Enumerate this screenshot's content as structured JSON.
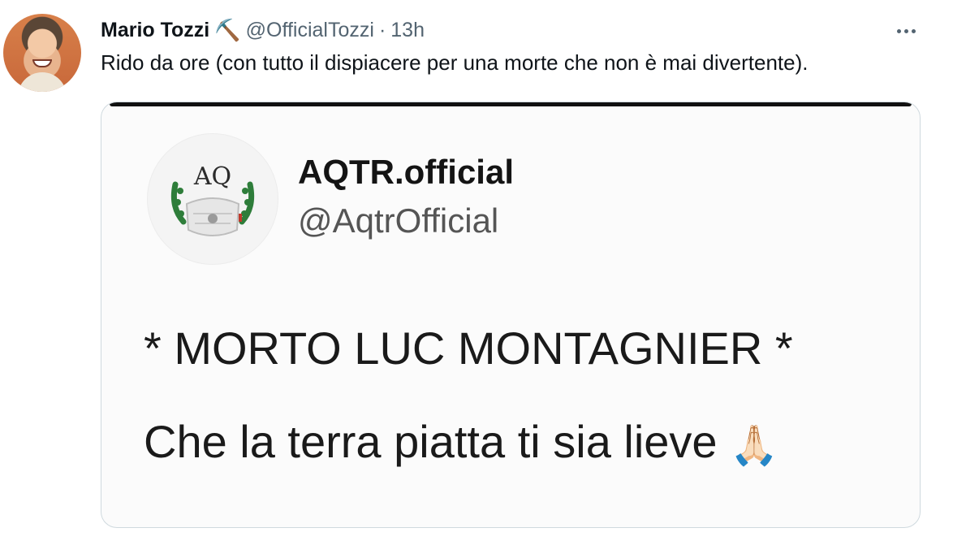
{
  "tweet": {
    "author_name": "Mario Tozzi",
    "author_emoji": "⛏️",
    "handle": "@OfficialTozzi",
    "separator": "·",
    "time": "13h",
    "text": "Rido da ore (con tutto il dispiacere per una morte che non è mai divertente)."
  },
  "media": {
    "quoted_name": "AQTR.official",
    "quoted_handle": "@AqtrOfficial",
    "logo_text": "AQ",
    "line1": "* MORTO LUC MONTAGNIER *",
    "line2": "Che la terra piatta ti sia lieve",
    "line2_emoji": "🙏🏻"
  },
  "icons": {
    "more": "more-icon",
    "pick": "pick-icon",
    "pray": "pray-icon"
  },
  "colors": {
    "name_text": "#0f1419",
    "secondary_text": "#536471",
    "card_border": "#cfd9de",
    "logo_green": "#2e7d3a"
  }
}
